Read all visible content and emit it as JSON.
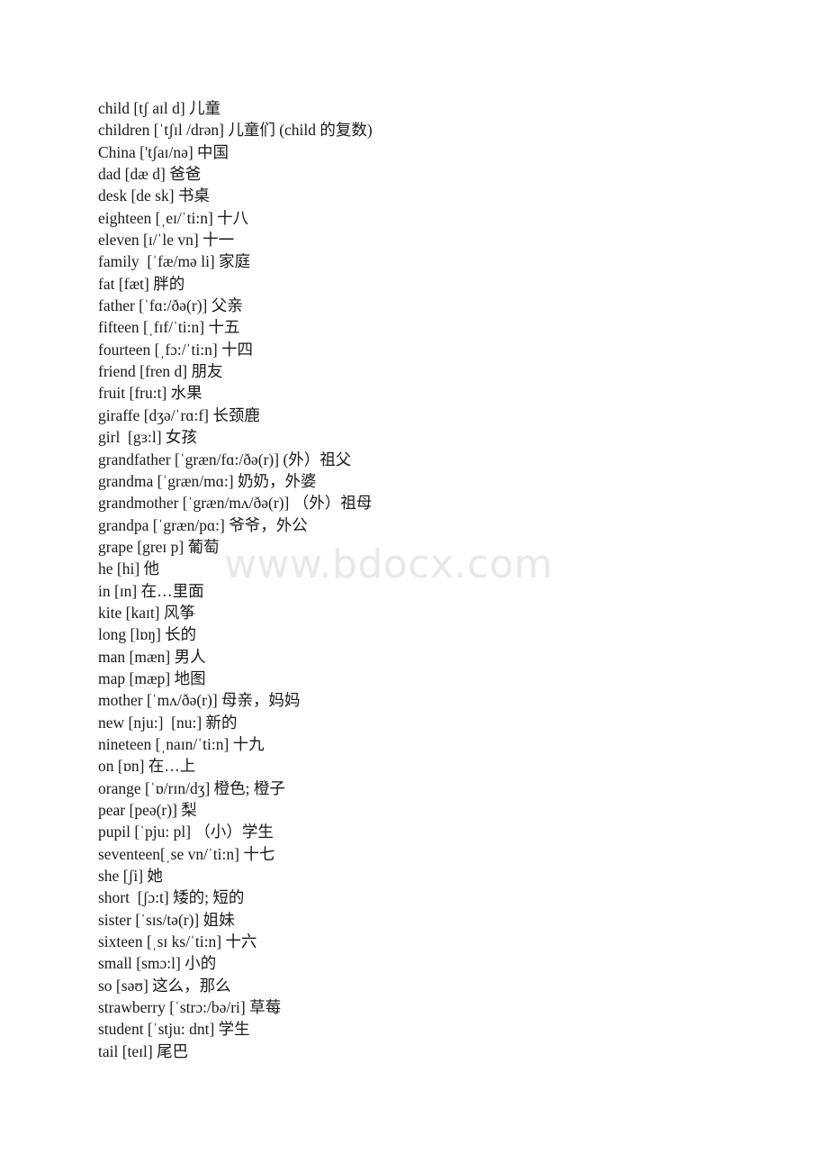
{
  "page": {
    "watermark": "www.bdocx.com",
    "background_color": "#ffffff",
    "text_color": "#1a1a1a",
    "watermark_color": "#e8e8e8"
  },
  "entries": [
    {
      "word": "child",
      "phonetic": "[tʃ aɪl d]",
      "meaning": "儿童",
      "line": "child [tʃ aɪl d] 儿童"
    },
    {
      "word": "children",
      "phonetic": "[ˈtʃɪl /drən]",
      "meaning": "儿童们 (child 的复数)",
      "line": "children [ˈtʃɪl /drən] 儿童们 (child 的复数)"
    },
    {
      "word": "China",
      "phonetic": "['tʃaɪ/nə]",
      "meaning": "中国",
      "line": "China ['tʃaɪ/nə] 中国"
    },
    {
      "word": "dad",
      "phonetic": "[dæ d]",
      "meaning": "爸爸",
      "line": "dad [dæ d] 爸爸"
    },
    {
      "word": "desk",
      "phonetic": "[de sk]",
      "meaning": "书桌",
      "line": "desk [de sk] 书桌"
    },
    {
      "word": "eighteen",
      "phonetic": "[ˌeɪ/ˈti:n]",
      "meaning": "十八",
      "line": "eighteen [ˌeɪ/ˈti:n] 十八"
    },
    {
      "word": "eleven",
      "phonetic": "[ɪ/ˈle vn]",
      "meaning": "十一",
      "line": "eleven [ɪ/ˈle vn] 十一"
    },
    {
      "word": "family",
      "phonetic": "[ˈfæ/mə li]",
      "meaning": "家庭",
      "line": "family  [ˈfæ/mə li] 家庭"
    },
    {
      "word": "fat",
      "phonetic": "[fæt]",
      "meaning": "胖的",
      "line": "fat [fæt] 胖的"
    },
    {
      "word": "father",
      "phonetic": "[ˈfɑ:/ðə(r)]",
      "meaning": "父亲",
      "line": "father [ˈfɑ:/ðə(r)] 父亲"
    },
    {
      "word": "fifteen",
      "phonetic": "[ˌfɪf/ˈti:n]",
      "meaning": "十五",
      "line": "fifteen [ˌfɪf/ˈti:n] 十五"
    },
    {
      "word": "fourteen",
      "phonetic": "[ˌfɔ:/ˈti:n]",
      "meaning": "十四",
      "line": "fourteen [ˌfɔ:/ˈti:n] 十四"
    },
    {
      "word": "friend",
      "phonetic": "[fren d]",
      "meaning": "朋友",
      "line": "friend [fren d] 朋友"
    },
    {
      "word": "fruit",
      "phonetic": "[fru:t]",
      "meaning": "水果",
      "line": "fruit [fru:t] 水果"
    },
    {
      "word": "giraffe",
      "phonetic": "[dʒə/ˈrɑ:f]",
      "meaning": "长颈鹿",
      "line": "giraffe [dʒə/ˈrɑ:f] 长颈鹿"
    },
    {
      "word": "girl",
      "phonetic": "[gɜ:l]",
      "meaning": "女孩",
      "line": "girl  [gɜ:l] 女孩"
    },
    {
      "word": "grandfather",
      "phonetic": "[ˈgræn/fɑ:/ðə(r)]",
      "meaning": "(外）祖父",
      "line": "grandfather [ˈgræn/fɑ:/ðə(r)] (外）祖父"
    },
    {
      "word": "grandma",
      "phonetic": "[ˈgræn/mɑ:]",
      "meaning": "奶奶，外婆",
      "line": "grandma [ˈgræn/mɑ:] 奶奶，外婆"
    },
    {
      "word": "grandmother",
      "phonetic": "[ˈgræn/mʌ/ðə(r)]",
      "meaning": "（外）祖母",
      "line": "grandmother [ˈgræn/mʌ/ðə(r)] （外）祖母"
    },
    {
      "word": "grandpa",
      "phonetic": "[ˈgræn/pɑ:]",
      "meaning": "爷爷，外公",
      "line": "grandpa [ˈgræn/pɑ:] 爷爷，外公"
    },
    {
      "word": "grape",
      "phonetic": "[greɪ p]",
      "meaning": "葡萄",
      "line": "grape [greɪ p] 葡萄"
    },
    {
      "word": "he",
      "phonetic": "[hi]",
      "meaning": "他",
      "line": "he [hi] 他"
    },
    {
      "word": "in",
      "phonetic": "[ɪn]",
      "meaning": "在…里面",
      "line": "in [ɪn] 在…里面"
    },
    {
      "word": "kite",
      "phonetic": "[kaɪt]",
      "meaning": "风筝",
      "line": "kite [kaɪt] 风筝"
    },
    {
      "word": "long",
      "phonetic": "[lɒŋ]",
      "meaning": "长的",
      "line": "long [lɒŋ] 长的"
    },
    {
      "word": "man",
      "phonetic": "[mæn]",
      "meaning": "男人",
      "line": "man [mæn] 男人"
    },
    {
      "word": "map",
      "phonetic": "[mæp]",
      "meaning": "地图",
      "line": "map [mæp] 地图"
    },
    {
      "word": "mother",
      "phonetic": "[ˈmʌ/ðə(r)]",
      "meaning": "母亲，妈妈",
      "line": "mother [ˈmʌ/ðə(r)] 母亲，妈妈"
    },
    {
      "word": "new",
      "phonetic": "[nju:]  [nu:]",
      "meaning": "新的",
      "line": "new [nju:]  [nu:] 新的"
    },
    {
      "word": "nineteen",
      "phonetic": "[ˌnaɪn/ˈti:n]",
      "meaning": "十九",
      "line": "nineteen [ˌnaɪn/ˈti:n] 十九"
    },
    {
      "word": "on",
      "phonetic": "[ɒn]",
      "meaning": "在…上",
      "line": "on [ɒn] 在…上"
    },
    {
      "word": "orange",
      "phonetic": "[ˈɒ/rɪn/dʒ]",
      "meaning": "橙色; 橙子",
      "line": "orange [ˈɒ/rɪn/dʒ] 橙色; 橙子"
    },
    {
      "word": "pear",
      "phonetic": "[peə(r)]",
      "meaning": "梨",
      "line": "pear [peə(r)] 梨"
    },
    {
      "word": "pupil",
      "phonetic": "[ˈpju: pl]",
      "meaning": "（小）学生",
      "line": "pupil [ˈpju: pl] （小）学生"
    },
    {
      "word": "seventeen",
      "phonetic": "[ˌse vn/ˈti:n]",
      "meaning": "十七",
      "line": "seventeen[ˌse vn/ˈti:n] 十七"
    },
    {
      "word": "she",
      "phonetic": "[ʃi]",
      "meaning": "她",
      "line": "she [ʃi] 她"
    },
    {
      "word": "short",
      "phonetic": "[ʃɔ:t]",
      "meaning": "矮的; 短的",
      "line": "short  [ʃɔ:t] 矮的; 短的"
    },
    {
      "word": "sister",
      "phonetic": "[ˈsɪs/tə(r)]",
      "meaning": "姐妹",
      "line": "sister [ˈsɪs/tə(r)] 姐妹"
    },
    {
      "word": "sixteen",
      "phonetic": "[ˌsɪ ks/ˈti:n]",
      "meaning": "十六",
      "line": "sixteen [ˌsɪ ks/ˈti:n] 十六"
    },
    {
      "word": "small",
      "phonetic": "[smɔ:l]",
      "meaning": "小的",
      "line": "small [smɔ:l] 小的"
    },
    {
      "word": "so",
      "phonetic": "[səʊ]",
      "meaning": "这么，那么",
      "line": "so [səʊ] 这么，那么"
    },
    {
      "word": "strawberry",
      "phonetic": "[ˈstrɔ:/bə/ri]",
      "meaning": "草莓",
      "line": "strawberry [ˈstrɔ:/bə/ri] 草莓"
    },
    {
      "word": "student",
      "phonetic": "[ˈstju: dnt]",
      "meaning": "学生",
      "line": "student [ˈstju: dnt] 学生"
    },
    {
      "word": "tail",
      "phonetic": "[teɪl]",
      "meaning": "尾巴",
      "line": "tail [teɪl] 尾巴"
    }
  ]
}
